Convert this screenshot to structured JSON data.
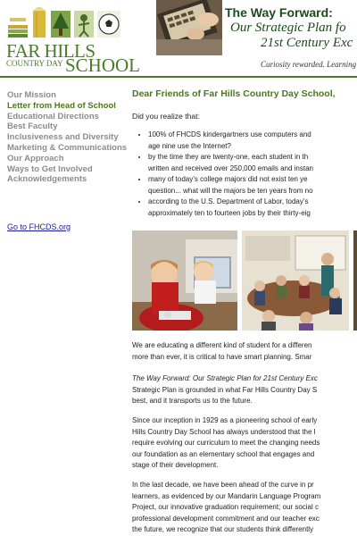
{
  "logo": {
    "line1": "FAR HILLS",
    "line2": "COUNTRY DAY",
    "line3": "SCHOOL"
  },
  "hero": {
    "title": "The Way Forward:",
    "subtitle_line1": "Our Strategic Plan fo",
    "subtitle_line2": "21st Century Exc",
    "tagline": "Curiosity rewarded. Learning"
  },
  "colors": {
    "brand_green": "#4a7a2a",
    "dark_green": "#1d4a1d",
    "nav_grey": "#8c8c8c",
    "link_blue": "#1a1a9a"
  },
  "sidebar": {
    "items": [
      {
        "label": "Our Mission",
        "active": false
      },
      {
        "label": "Letter from Head of School",
        "active": true
      },
      {
        "label": "Educational Directions",
        "active": false
      },
      {
        "label": "Best Faculty",
        "active": false
      },
      {
        "label": "Inclusiveness and Diversity",
        "active": false
      },
      {
        "label": "Marketing & Communications",
        "active": false
      },
      {
        "label": "Our Approach",
        "active": false
      },
      {
        "label": "Ways to Get Involved",
        "active": false
      },
      {
        "label": "Acknowledgements",
        "active": false
      }
    ],
    "link": "Go to FHCDS.org"
  },
  "main": {
    "heading": "Dear Friends of Far Hills Country Day School,",
    "intro": "Did you realize that:",
    "bullets": [
      {
        "l1": "100% of FHCDS kindergartners use computers and",
        "l2": "age nine use the Internet?"
      },
      {
        "l1": "by the time they are twenty-one, each student in th",
        "l2": "written and received over 250,000 emails and instan"
      },
      {
        "l1": "many of today’s college majors did not exist ten ye",
        "l2": "question... what will the majors be ten years from no"
      },
      {
        "l1": "according to the U.S. Department of Labor, today’s",
        "l2": "approximately ten to fourteen jobs by their thirty-eig"
      }
    ],
    "para1": {
      "l1": "We are educating a different kind of student for a differen",
      "l2": "more than ever, it is critical to have smart planning. Smar"
    },
    "para2": {
      "italic": "The Way Forward: Our Strategic Plan for 21st Century Exc",
      "l2": "Strategic Plan is grounded in what Far Hills Country Day S",
      "l3": "best, and it transports us to the future."
    },
    "para3": {
      "l1": "Since our inception in 1929 as a pioneering school of early",
      "l2": "Hills Country Day School has always understood that the l",
      "l3": "require evolving our curriculum to meet the changing needs",
      "l4": "our foundation as an elementary school that engages and",
      "l5": "stage of their development."
    },
    "para4": {
      "l1": "In the last decade, we have been ahead of the curve in pr",
      "l2": "learners, as evidenced by our Mandarin Language Program",
      "l3": "Project, our innovative graduation requirement; our social c",
      "l4": "professional development commitment and our teacher exc",
      "l5": "the future, we recognize that our students think differently"
    }
  }
}
